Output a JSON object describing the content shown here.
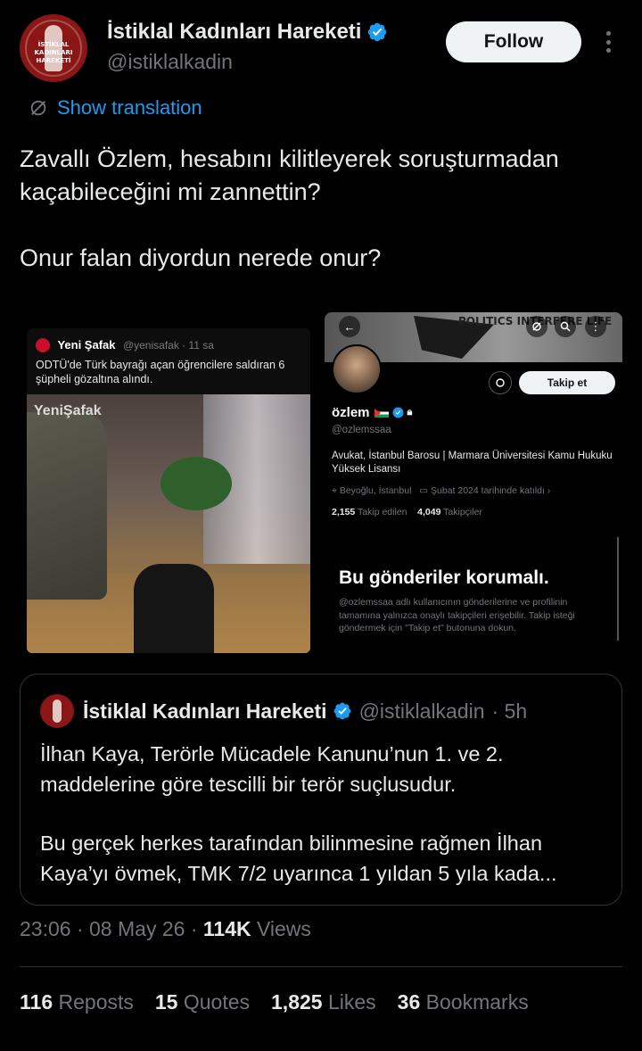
{
  "author": {
    "display_name": "İstiklal Kadınları Hareketi",
    "handle": "@istiklalkadin",
    "avatar_text": "İSTİKLAL KADINLARI HAREKETİ",
    "verified": true
  },
  "actions": {
    "follow_label": "Follow"
  },
  "translate_label": "Show translation",
  "tweet": {
    "line1": "Zavallı Özlem, hesabını kilitleyerek soruşturmadan kaçabileceğini mi zannettin?",
    "line2": "Onur falan diyordun nerede onur?"
  },
  "media_left": {
    "source_name": "Yeni Şafak",
    "source_handle": "@yenisafak · 11 sa",
    "headline": "ODTÜ'de Türk bayrağı açan öğrencilere saldıran 6 şüpheli gözaltına alındı.",
    "watermark": "YeniŞafak"
  },
  "media_right": {
    "banner_text": "POLITICS INTERFERE LIFE",
    "back_glyph": "←",
    "follow_label": "Takip et",
    "name": "özlem",
    "handle": "@ozlemssaa",
    "bio": "Avukat, İstanbul Barosu | Marmara Üniversitesi Kamu Hukuku Yüksek Lisansı",
    "location": "Beyoğlu, İstanbul",
    "joined": "Şubat 2024 tarihinde katıldı",
    "following_count": "2,155",
    "following_label": "Takip edilen",
    "followers_count": "4,049",
    "followers_label": "Takipçiler",
    "protected_title": "Bu gönderiler korumalı.",
    "protected_body": "@ozlemssaa adlı kullanıcının gönderilerine ve profilinin tamamına yalnızca onaylı takipçileri erişebilir. Takip isteği göndermek için \"Takip et\" butonuna dokun."
  },
  "quote": {
    "display_name": "İstiklal Kadınları Hareketi",
    "handle": "@istiklalkadin",
    "time": "· 5h",
    "para1": "İlhan Kaya, Terörle Mücadele Kanunu’nun 1. ve 2. maddelerine göre tescilli bir terör suçlusudur.",
    "para2": "Bu gerçek herkes tarafından bilinmesine rağmen İlhan Kaya’yı övmek, TMK 7/2 uyarınca 1 yıldan 5 yıla kada..."
  },
  "meta": {
    "time": "23:06",
    "date": "08 May 26",
    "views_count": "114K",
    "views_label": "Views"
  },
  "stats": {
    "reposts_count": "116",
    "reposts_label": "Reposts",
    "quotes_count": "15",
    "quotes_label": "Quotes",
    "likes_count": "1,825",
    "likes_label": "Likes",
    "bookmarks_count": "36",
    "bookmarks_label": "Bookmarks"
  },
  "colors": {
    "background": "#000000",
    "accent": "#1d9bf0",
    "text_primary": "#e7e9ea",
    "text_secondary": "#71767b",
    "border": "#2f3336"
  },
  "icons": {
    "verified": "verified-badge-icon",
    "translate": "translate-icon",
    "more": "more-options-icon",
    "lock": "lock-icon"
  }
}
